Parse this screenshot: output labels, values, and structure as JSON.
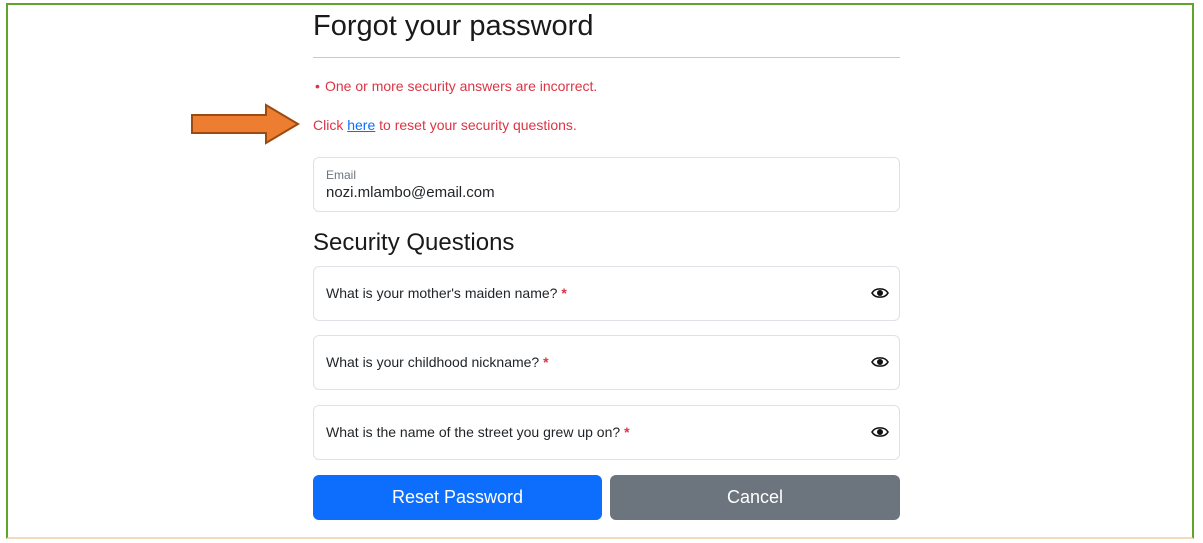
{
  "page": {
    "title": "Forgot your password",
    "errors": [
      "One or more security answers are incorrect."
    ],
    "reset_prefix": "Click ",
    "reset_link": "here",
    "reset_suffix": " to reset your security questions."
  },
  "email": {
    "label": "Email",
    "value": "nozi.mlambo@email.com"
  },
  "security": {
    "title": "Security Questions",
    "required_marker": "*",
    "questions": [
      {
        "label": "What is your mother's maiden name?",
        "icon": "eye-icon"
      },
      {
        "label": "What is your childhood nickname?",
        "icon": "eye-icon"
      },
      {
        "label": "What is the name of the street you grew up on?",
        "icon": "eye-icon"
      }
    ]
  },
  "actions": {
    "reset_label": "Reset Password",
    "cancel_label": "Cancel"
  },
  "colors": {
    "primary": "#0d6efd",
    "secondary": "#6c757d",
    "error": "#dc3545",
    "annotation_arrow": "#ed7d31",
    "frame_border": "#5fa52d"
  }
}
